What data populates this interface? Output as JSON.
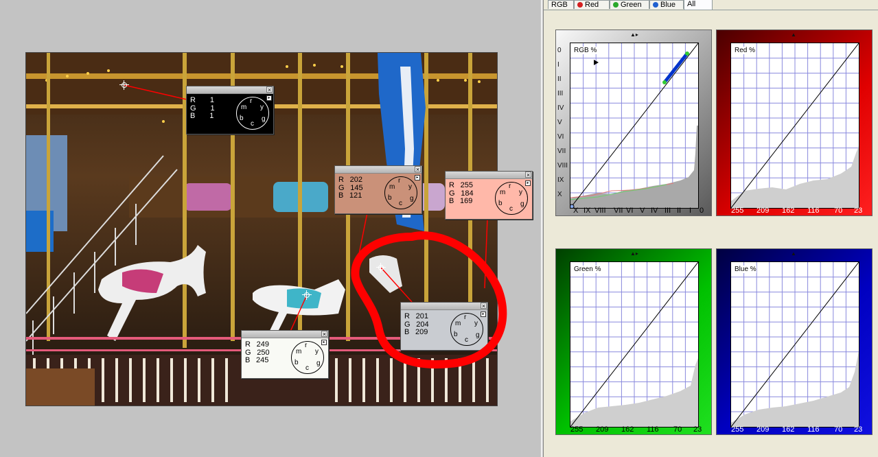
{
  "tabs": [
    {
      "label": "RGB",
      "dot": ""
    },
    {
      "label": "Red",
      "dot": "#d42020"
    },
    {
      "label": "Green",
      "dot": "#2aa82a"
    },
    {
      "label": "Blue",
      "dot": "#2060d0"
    },
    {
      "label": "All",
      "dot": ""
    }
  ],
  "active_tab": "All",
  "probe_letters": {
    "m": "m",
    "r": "r",
    "y": "y",
    "g": "g",
    "c": "c",
    "b": "b"
  },
  "probe_labels": {
    "r": "R",
    "g": "G",
    "b": "B"
  },
  "probes": [
    {
      "r": "1",
      "g": "1",
      "b": "1",
      "bg": "#000000",
      "fg": "#ffffff"
    },
    {
      "r": "202",
      "g": "145",
      "b": "121",
      "bg": "#ca9179",
      "fg": "#000000"
    },
    {
      "r": "255",
      "g": "184",
      "b": "169",
      "bg": "#ffb8a9",
      "fg": "#000000"
    },
    {
      "r": "201",
      "g": "204",
      "b": "209",
      "bg": "#c9ccd1",
      "fg": "#000000"
    },
    {
      "r": "249",
      "g": "250",
      "b": "245",
      "bg": "#f9faf5",
      "fg": "#000000"
    }
  ],
  "panels": {
    "rgb": {
      "title": "RGB %",
      "ticks": [
        "X",
        "IX",
        "VIII",
        "VII",
        "VI",
        "V",
        "IV",
        "III",
        "II",
        "I",
        "0"
      ],
      "zones": [
        "0",
        "I",
        "II",
        "III",
        "IV",
        "V",
        "VI",
        "VII",
        "VIII",
        "IX",
        "X"
      ]
    },
    "red": {
      "title": "Red %",
      "ticks": [
        "255",
        "209",
        "162",
        "116",
        "70",
        "23"
      ],
      "color": "#cc0000"
    },
    "green": {
      "title": "Green %",
      "ticks": [
        "255",
        "209",
        "162",
        "116",
        "70",
        "23"
      ],
      "color": "#00b000"
    },
    "blue": {
      "title": "Blue %",
      "ticks": [
        "255",
        "209",
        "162",
        "116",
        "70",
        "23"
      ],
      "color": "#0000a8"
    }
  },
  "colors": {
    "annotation": "#ff0000",
    "leader": "#ff0000"
  }
}
